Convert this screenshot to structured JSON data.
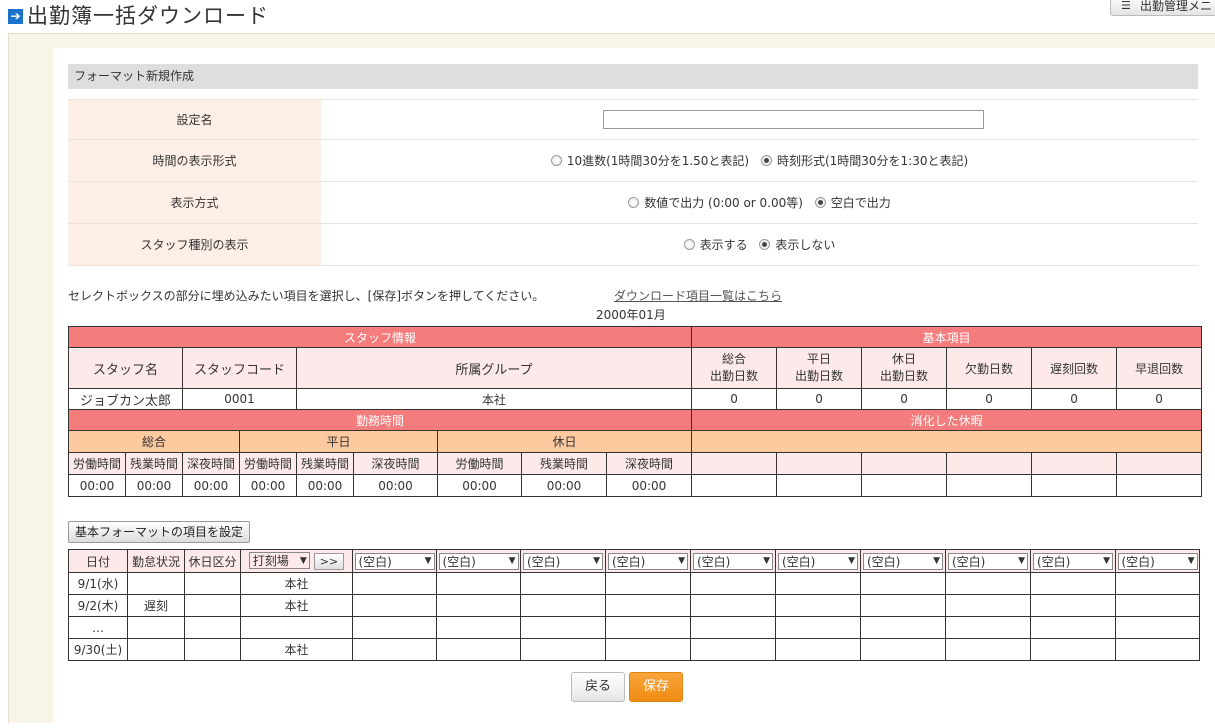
{
  "header": {
    "title": "出勤簿一括ダウンロード",
    "menu_label": "出勤管理メニ"
  },
  "section": {
    "title": "フォーマット新規作成"
  },
  "settings": {
    "name_label": "設定名",
    "name_value": "",
    "time_format_label": "時間の表示形式",
    "time_format_option1": "10進数(1時間30分を1.50と表記)",
    "time_format_option2": "時刻形式(1時間30分を1:30と表記)",
    "display_label": "表示方式",
    "display_option1": "数値で出力 (0:00 or 0.00等)",
    "display_option2": "空白で出力",
    "staff_type_label": "スタッフ種別の表示",
    "staff_type_option1": "表示する",
    "staff_type_option2": "表示しない"
  },
  "instruction": "セレクトボックスの部分に埋め込みたい項目を選択し、[保存]ボタンを押してください。",
  "download_link": "ダウンロード項目一覧はこちら",
  "month": "2000年01月",
  "summary": {
    "staff_info": "スタッフ情報",
    "basic_items": "基本項目",
    "col_staff_name": "スタッフ名",
    "col_staff_code": "スタッフコード",
    "col_group": "所属グループ",
    "col_total_days": [
      "総合",
      "出勤日数"
    ],
    "col_weekday_days": [
      "平日",
      "出勤日数"
    ],
    "col_holiday_days": [
      "休日",
      "出勤日数"
    ],
    "col_absent": "欠勤日数",
    "col_late": "遅刻回数",
    "col_early": "早退回数",
    "row": {
      "name": "ジョブカン太郎",
      "code": "0001",
      "group": "本社",
      "total": "0",
      "weekday": "0",
      "holiday": "0",
      "absent": "0",
      "late": "0",
      "early": "0"
    },
    "work_time": "勤務時間",
    "used_leave": "消化した休暇",
    "total": "総合",
    "weekday": "平日",
    "holiday": "休日",
    "labor": "労働時間",
    "overtime": "残業時間",
    "night": "深夜時間",
    "zero": "00:00"
  },
  "daily": {
    "button": "基本フォーマットの項目を設定",
    "col_date": "日付",
    "col_status": "勤怠状況",
    "col_holiday_type": "休日区分",
    "clock_select": "打刻場",
    "arrow": ">>",
    "blank_option": "(空白)",
    "rows": [
      {
        "date": "9/1(水)",
        "status": "",
        "holiday": "",
        "place": "本社"
      },
      {
        "date": "9/2(木)",
        "status": "遅刻",
        "holiday": "",
        "place": "本社"
      },
      {
        "date": "…",
        "status": "",
        "holiday": "",
        "place": ""
      },
      {
        "date": "9/30(土)",
        "status": "",
        "holiday": "",
        "place": "本社"
      }
    ]
  },
  "buttons": {
    "back": "戻る",
    "save": "保存"
  }
}
